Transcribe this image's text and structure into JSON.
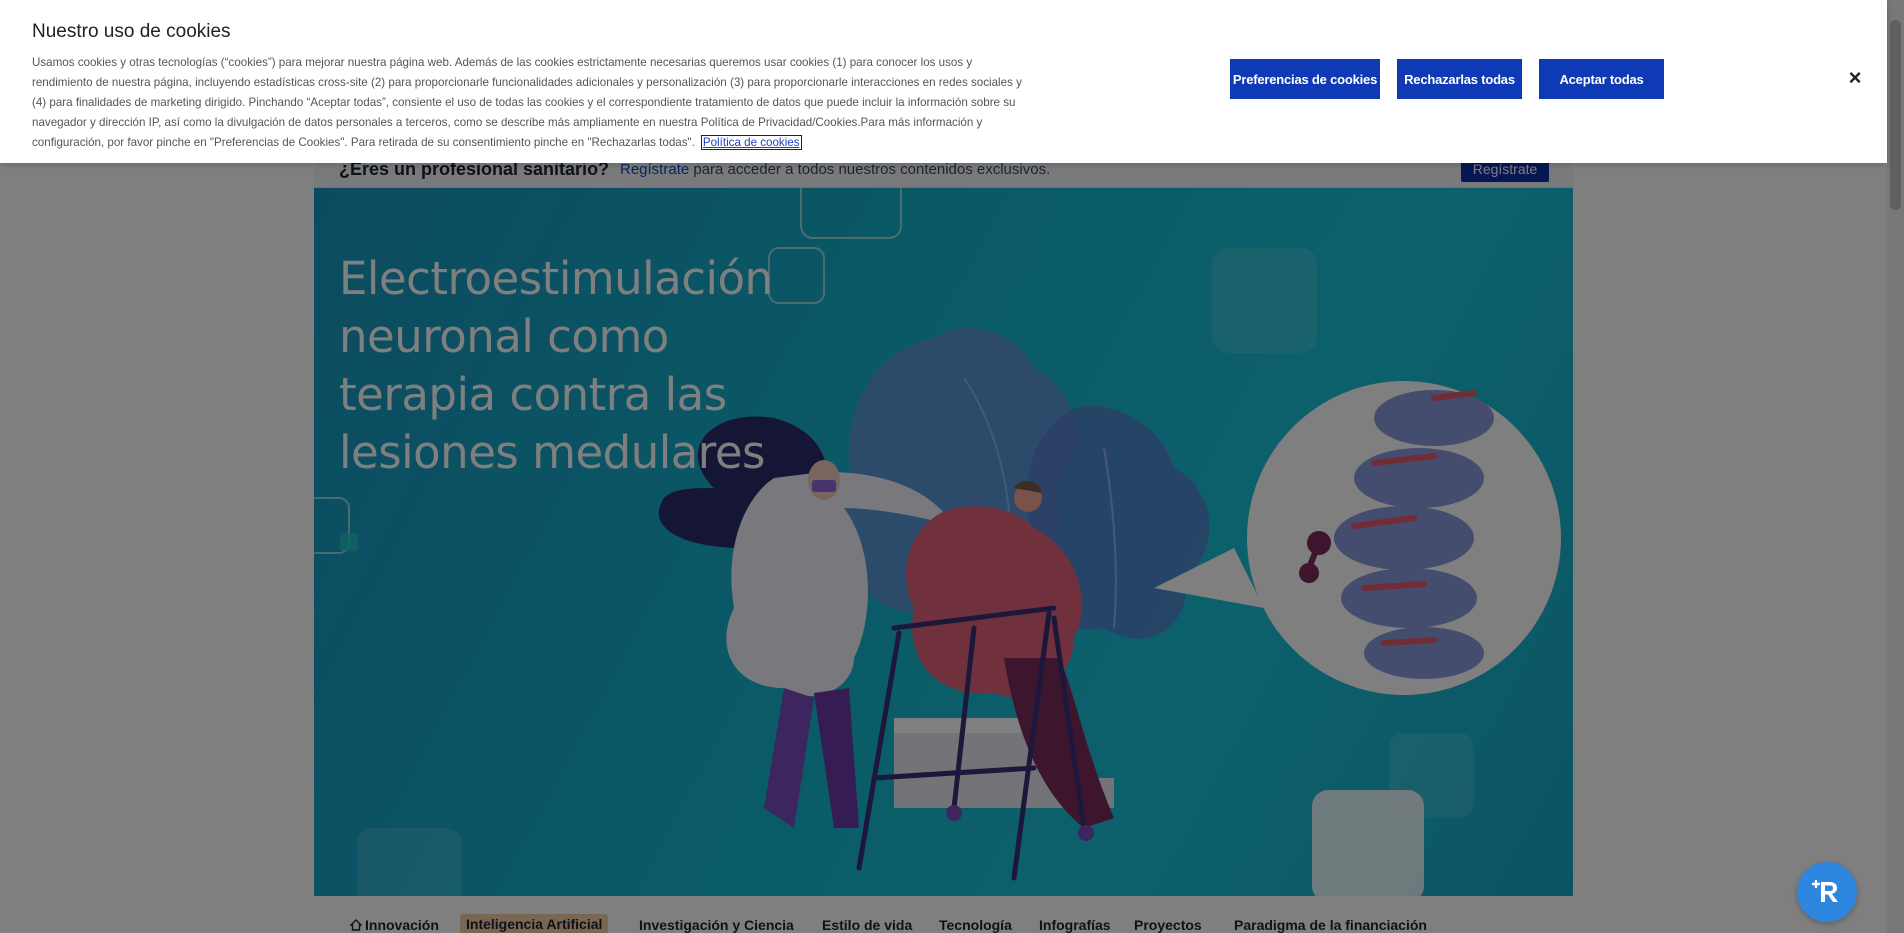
{
  "cookie_banner": {
    "title": "Nuestro uso de cookies",
    "body": "Usamos cookies y otras tecnologías (“cookies”) para mejorar nuestra página web. Además de las cookies estrictamente necesarias queremos usar cookies (1) para conocer los usos y rendimiento de nuestra página, incluyendo estadísticas cross-site (2) para proporcionarle funcionalidades adicionales y personalización (3) para proporcionarle interacciones en redes sociales y (4) para finalidades de marketing dirigido. Pinchando “Aceptar todas”, consiente el uso de todas las cookies y el correspondiente tratamiento de datos que puede incluir la información sobre su navegador y dirección IP, así como la divulgación de datos personales a terceros, como se describe más ampliamente en nuestra Política de Privacidad/Cookies.Para más información y configuración, por favor pinche en \"Preferencias de Cookies\". Para retirada de su consentimiento pinche en \"Rechazarlas todas\".",
    "policy_link": "Política de cookies",
    "preferences_button": "Preferencias de cookies",
    "reject_button": "Rechazarlas todas",
    "accept_button": "Aceptar todas",
    "close_label": "×"
  },
  "pro_banner": {
    "question": "¿Eres un profesional sanitario?",
    "register_link": "Regístrate",
    "text_rest": " para acceder a todos nuestros contenidos exclusivos.",
    "register_button": "Regístrate"
  },
  "hero": {
    "title": "Electroestimulación neuronal como terapia contra las lesiones medulares"
  },
  "tabs": [
    {
      "label": "Innovación"
    },
    {
      "label": "Inteligencia Artificial"
    },
    {
      "label": "Investigación y Ciencia"
    },
    {
      "label": "Estilo de vida"
    },
    {
      "label": "Tecnología"
    },
    {
      "label": "Infografías"
    },
    {
      "label": "Proyectos"
    },
    {
      "label": "Paradigma de la financiación"
    }
  ],
  "colors": {
    "accent": "#0f3ab5",
    "hero_teal": "#14b5cf",
    "active_tab": "#f2cfa8",
    "chat": "#2e86de"
  }
}
